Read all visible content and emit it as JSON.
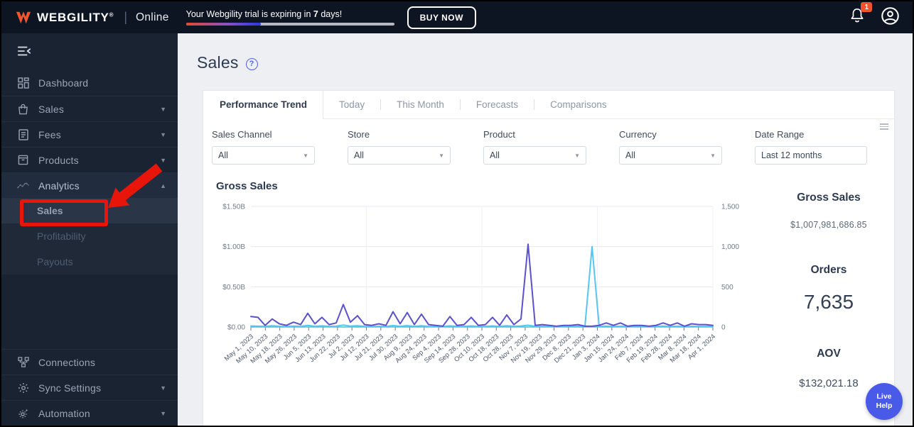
{
  "topbar": {
    "brand": "WEBGILITY",
    "reg": "®",
    "divider": "|",
    "product": "Online",
    "trial_prefix": "Your Webgility trial is expiring in ",
    "trial_days": "7",
    "trial_suffix": " days!",
    "progress_percent": 36,
    "buy_now": "BUY NOW",
    "notification_count": "1"
  },
  "sidebar": {
    "items": [
      {
        "label": "Dashboard",
        "icon": "dashboard-icon"
      },
      {
        "label": "Sales",
        "icon": "sales-icon",
        "chevron": "down"
      },
      {
        "label": "Fees",
        "icon": "fees-icon",
        "chevron": "down"
      },
      {
        "label": "Products",
        "icon": "products-icon",
        "chevron": "down"
      },
      {
        "label": "Analytics",
        "icon": "analytics-icon",
        "chevron": "up",
        "active": true
      }
    ],
    "submenu": [
      {
        "label": "Sales",
        "active": true
      },
      {
        "label": "Profitability"
      },
      {
        "label": "Payouts"
      }
    ],
    "bottom": [
      {
        "label": "Connections",
        "icon": "connections-icon"
      },
      {
        "label": "Sync Settings",
        "icon": "gear-icon",
        "chevron": "down"
      },
      {
        "label": "Automation",
        "icon": "automation-icon",
        "chevron": "down"
      }
    ]
  },
  "main": {
    "title": "Sales",
    "tabs": [
      "Performance Trend",
      "Today",
      "This Month",
      "Forecasts",
      "Comparisons"
    ],
    "active_tab": "Performance Trend",
    "filters": [
      {
        "label": "Sales Channel",
        "value": "All"
      },
      {
        "label": "Store",
        "value": "All"
      },
      {
        "label": "Product",
        "value": "All"
      },
      {
        "label": "Currency",
        "value": "All"
      },
      {
        "label": "Date Range",
        "value": "Last 12 months"
      }
    ]
  },
  "stats": [
    {
      "label": "Gross Sales",
      "value": "$1,007,981,686.85"
    },
    {
      "label": "Orders",
      "value": "7,635"
    },
    {
      "label": "AOV",
      "value": "$132,021.18"
    }
  ],
  "chart_data": {
    "type": "line",
    "title": "Gross Sales",
    "x_labels": [
      "May 1, 2023",
      "May 10, 2023",
      "May 18, 2023",
      "May 26, 2023",
      "Jun 5, 2023",
      "Jun 13, 2023",
      "Jun 22, 2023",
      "Jul 2, 2023",
      "Jul 12, 2023",
      "Jul 21, 2023",
      "Jul 30, 2023",
      "Aug 9, 2023",
      "Aug 24, 2023",
      "Sep 4, 2023",
      "Sep 14, 2023",
      "Sep 28, 2023",
      "Oct 10, 2023",
      "Oct 18, 2023",
      "Oct 28, 2023",
      "Nov 7, 2023",
      "Nov 19, 2023",
      "Nov 29, 2023",
      "Dec 8, 2023",
      "Dec 21, 2023",
      "Jan 3, 2024",
      "Jan 15, 2024",
      "Jan 24, 2024",
      "Feb 7, 2024",
      "Feb 19, 2024",
      "Feb 28, 2024",
      "Mar 8, 2024",
      "Mar 18, 2024",
      "Apr 1, 2024"
    ],
    "left_axis": {
      "ticks": [
        "$1.50B",
        "$1.00B",
        "$0.50B",
        "$0.00"
      ],
      "max": 1.5,
      "unit": "billions_usd"
    },
    "right_axis": {
      "ticks": [
        "1,500",
        "1,000",
        "500",
        "0"
      ],
      "max": 1500,
      "unit": "count"
    },
    "v_grid_every": 8,
    "grid": true,
    "series": [
      {
        "name": "AOV",
        "color": "#3ec6cd",
        "axis": "left",
        "flat_value": 0.0001,
        "points": 66,
        "width": 1.5
      },
      {
        "name": "Orders",
        "color": "#55c6f2",
        "axis": "right",
        "width": 2,
        "values": [
          12,
          10,
          8,
          15,
          9,
          7,
          11,
          8,
          20,
          9,
          14,
          8,
          10,
          25,
          11,
          16,
          8,
          7,
          9,
          7,
          18,
          9,
          17,
          8,
          15,
          8,
          7,
          6,
          14,
          8,
          9,
          13,
          7,
          8,
          13,
          7,
          15,
          9,
          12,
          22,
          8,
          9,
          7,
          6,
          8,
          8,
          9,
          6,
          1000,
          8,
          11,
          8,
          10,
          6,
          8,
          8,
          6,
          8,
          11,
          8,
          10,
          6,
          9,
          8,
          8,
          7
        ]
      },
      {
        "name": "Gross Sales",
        "color": "#5b51cc",
        "axis": "left",
        "width": 2,
        "values": [
          0.13,
          0.12,
          0.02,
          0.1,
          0.04,
          0.02,
          0.06,
          0.03,
          0.17,
          0.04,
          0.12,
          0.03,
          0.05,
          0.28,
          0.06,
          0.14,
          0.03,
          0.02,
          0.04,
          0.02,
          0.19,
          0.04,
          0.18,
          0.03,
          0.16,
          0.03,
          0.02,
          0.01,
          0.13,
          0.02,
          0.03,
          0.12,
          0.02,
          0.03,
          0.12,
          0.02,
          0.15,
          0.03,
          0.1,
          1.03,
          0.02,
          0.03,
          0.02,
          0.01,
          0.02,
          0.02,
          0.03,
          0.01,
          0.01,
          0.02,
          0.05,
          0.02,
          0.05,
          0.01,
          0.02,
          0.02,
          0.01,
          0.02,
          0.05,
          0.02,
          0.05,
          0.01,
          0.04,
          0.03,
          0.03,
          0.02
        ]
      }
    ]
  },
  "annotation": {
    "type": "red box and arrow",
    "target": "Analytics > Sales",
    "color": "#e8150b"
  },
  "live_help": {
    "line1": "Live",
    "line2": "Help"
  }
}
